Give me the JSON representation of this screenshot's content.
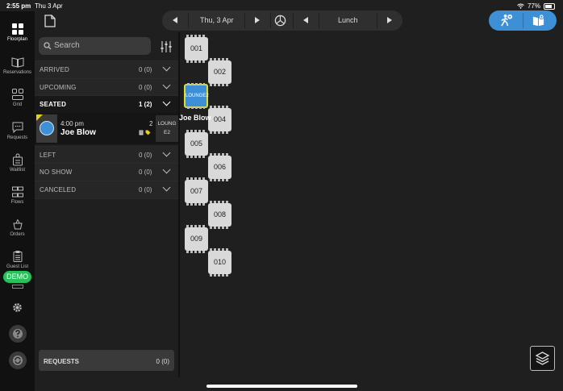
{
  "status_bar": {
    "time": "2:55 pm",
    "date": "Thu 3 Apr",
    "battery": "77%"
  },
  "sidebar": {
    "items": [
      {
        "label": "Floorplan",
        "icon": "floorplan-icon",
        "active": true
      },
      {
        "label": "Reservations",
        "icon": "book-icon"
      },
      {
        "label": "Grid",
        "icon": "grid-icon"
      },
      {
        "label": "Requests",
        "icon": "chat-icon"
      },
      {
        "label": "Waitlist",
        "icon": "waitlist-icon"
      },
      {
        "label": "Flows",
        "icon": "flows-icon"
      },
      {
        "label": "Orders",
        "icon": "orders-icon"
      },
      {
        "label": "Guest List",
        "icon": "clipboard-icon"
      }
    ],
    "demo_badge": "DEMO"
  },
  "topbar": {
    "date_label": "Thu, 3 Apr",
    "shift_label": "Lunch"
  },
  "search": {
    "placeholder": "Search"
  },
  "sections": [
    {
      "label": "ARRIVED",
      "count": "0 (0)"
    },
    {
      "label": "UPCOMING",
      "count": "0 (0)"
    },
    {
      "label": "SEATED",
      "count": "1 (2)"
    },
    {
      "label": "LEFT",
      "count": "0 (0)"
    },
    {
      "label": "NO SHOW",
      "count": "0 (0)"
    },
    {
      "label": "CANCELED",
      "count": "0 (0)"
    }
  ],
  "reservation": {
    "time": "4:00 pm",
    "name": "Joe Blow",
    "party_size": "2",
    "table_line1": "LOUNG",
    "table_line2": "E2"
  },
  "requests": {
    "label": "REQUESTS",
    "count": "0 (0)"
  },
  "floorplan": {
    "tables": [
      "001",
      "002",
      "LOUNGE2",
      "004",
      "005",
      "006",
      "007",
      "008",
      "009",
      "010"
    ],
    "seated_guest": "Joe Blow"
  },
  "colors": {
    "accent": "#3d8fd6",
    "demo": "#27c05a",
    "highlight": "#d9e02a"
  }
}
